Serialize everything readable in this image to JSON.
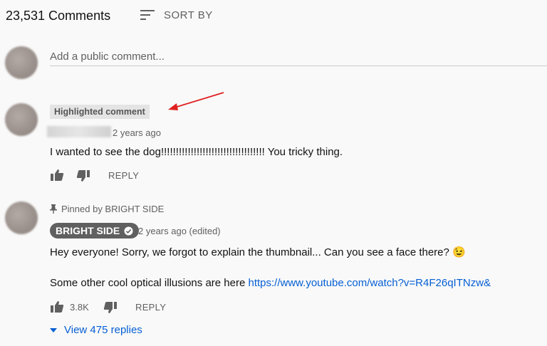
{
  "header": {
    "count_label": "23,531 Comments",
    "sort_label": "SORT BY"
  },
  "add_comment": {
    "placeholder": "Add a public comment..."
  },
  "highlighted": {
    "badge": "Highlighted comment",
    "time": "2 years ago",
    "text": "I wanted to see the dog!!!!!!!!!!!!!!!!!!!!!!!!!!!!!!!!!!! You tricky thing.",
    "reply_label": "REPLY"
  },
  "pinned": {
    "pinned_label": "Pinned by BRIGHT SIDE",
    "author": "BRIGHT SIDE",
    "time": "2 years ago (edited)",
    "line1": "Hey everyone! Sorry, we forgot to explain the thumbnail... Can you see a face there? 😉",
    "line2_text": "Some other cool optical illusions are here ",
    "line2_link": "https://www.youtube.com/watch?v=R4F26qITNzw&",
    "likes": "3.8K",
    "reply_label": "REPLY",
    "view_replies": "View 475 replies"
  },
  "colors": {
    "link": "#065fd4",
    "annotation_arrow": "#e02020",
    "chip_bg": "#606060"
  },
  "icons": [
    "sort-icon",
    "thumbs-up-icon",
    "thumbs-down-icon",
    "pin-icon",
    "verified-check-icon",
    "caret-down-icon",
    "red-arrow-annotation"
  ]
}
